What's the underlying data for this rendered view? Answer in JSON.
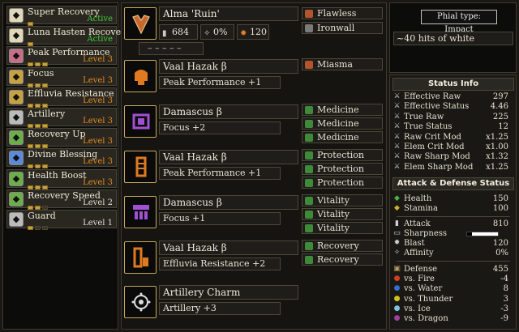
{
  "skills": [
    {
      "name": "Super Recovery",
      "level": "Active",
      "level_color": "act",
      "icon": "super-recovery-icon",
      "icon_color": "#e0d8b8",
      "bars": 1,
      "filled": 1
    },
    {
      "name": "Luna Hasten Recovery",
      "level": "Active",
      "level_color": "act",
      "icon": "hasten-recovery-icon",
      "icon_color": "#e0d8b8",
      "bars": 1,
      "filled": 1
    },
    {
      "name": "Peak Performance",
      "level": "Level 3",
      "level_color": "orange",
      "icon": "peak-performance-icon",
      "icon_color": "#c86d8a",
      "bars": 3,
      "filled": 3
    },
    {
      "name": "Focus",
      "level": "Level 3",
      "level_color": "orange",
      "icon": "focus-icon",
      "icon_color": "#c8a240",
      "bars": 3,
      "filled": 3
    },
    {
      "name": "Effluvia Resistance",
      "level": "Level 3",
      "level_color": "orange",
      "icon": "effluvia-resistance-icon",
      "icon_color": "#c8a240",
      "bars": 3,
      "filled": 3
    },
    {
      "name": "Artillery",
      "level": "Level 3",
      "level_color": "orange",
      "icon": "artillery-icon",
      "icon_color": "#bbbbbb",
      "bars": 3,
      "filled": 3
    },
    {
      "name": "Recovery Up",
      "level": "Level 3",
      "level_color": "orange",
      "icon": "recovery-up-icon",
      "icon_color": "#6cae4a",
      "bars": 3,
      "filled": 3
    },
    {
      "name": "Divine Blessing",
      "level": "Level 3",
      "level_color": "orange",
      "icon": "divine-blessing-icon",
      "icon_color": "#5a8ad8",
      "bars": 3,
      "filled": 3
    },
    {
      "name": "Health Boost",
      "level": "Level 3",
      "level_color": "orange",
      "icon": "health-boost-icon",
      "icon_color": "#6cae4a",
      "bars": 3,
      "filled": 3
    },
    {
      "name": "Recovery Speed",
      "level": "Level 2",
      "level_color": "white",
      "icon": "recovery-speed-icon",
      "icon_color": "#6cae4a",
      "bars": 3,
      "filled": 2
    },
    {
      "name": "Guard",
      "level": "Level 1",
      "level_color": "white",
      "icon": "guard-icon",
      "icon_color": "#bbbbbb",
      "bars": 3,
      "filled": 1
    }
  ],
  "weapon": {
    "name": "Alma 'Ruin'",
    "attack": "684",
    "affinity": "0%",
    "element": "120",
    "slot_dash": "– – – – –",
    "decos": [
      "Flawless",
      "Ironwall"
    ],
    "deco_colors": [
      "red",
      "gray"
    ],
    "icon": "charge-blade-icon"
  },
  "armor": [
    {
      "name": "Vaal Hazak β",
      "skill": "Peak Performance +1",
      "decos": [
        "Miasma"
      ],
      "deco_colors": [
        "red"
      ],
      "icon": "helm-icon",
      "icon_color": "#e07a20"
    },
    {
      "name": "Damascus β",
      "skill": "Focus +2",
      "decos": [
        "Medicine",
        "Medicine",
        "Medicine"
      ],
      "deco_colors": [
        "green",
        "green",
        "green"
      ],
      "icon": "chest-icon",
      "icon_color": "#a050d0"
    },
    {
      "name": "Vaal Hazak β",
      "skill": "Peak Performance +1",
      "decos": [
        "Protection",
        "Protection",
        "Protection"
      ],
      "deco_colors": [
        "green",
        "green",
        "green"
      ],
      "icon": "arms-icon",
      "icon_color": "#e07a20"
    },
    {
      "name": "Damascus β",
      "skill": "Focus +1",
      "decos": [
        "Vitality",
        "Vitality",
        "Vitality"
      ],
      "deco_colors": [
        "green",
        "green",
        "green"
      ],
      "icon": "waist-icon",
      "icon_color": "#a050d0"
    },
    {
      "name": "Vaal Hazak β",
      "skill": "Effluvia Resistance +2",
      "decos": [
        "Recovery",
        "Recovery"
      ],
      "deco_colors": [
        "green",
        "green"
      ],
      "icon": "legs-icon",
      "icon_color": "#e07a20"
    }
  ],
  "charm": {
    "name": "Artillery Charm",
    "skill": "Artillery +3",
    "icon": "charm-icon"
  },
  "phial": {
    "type": "Phial type: Impact",
    "desc": "~40 hits of white"
  },
  "status": {
    "header": "Status Info",
    "rows": [
      {
        "label": "Effective Raw",
        "value": "297",
        "icon": "sword-icon"
      },
      {
        "label": "Effective Status",
        "value": "4.46",
        "icon": "sword-icon"
      },
      {
        "label": "True Raw",
        "value": "225",
        "icon": "sword-icon"
      },
      {
        "label": "True Status",
        "value": "12",
        "icon": "sword-icon"
      },
      {
        "label": "Raw Crit Mod",
        "value": "x1.25",
        "icon": "sword-icon"
      },
      {
        "label": "Elem Crit Mod",
        "value": "x1.00",
        "icon": "sword-icon"
      },
      {
        "label": "Raw Sharp Mod",
        "value": "x1.32",
        "icon": "sword-icon"
      },
      {
        "label": "Elem Sharp Mod",
        "value": "x1.25",
        "icon": "sword-icon"
      }
    ]
  },
  "attack_defense": {
    "header": "Attack & Defense Status",
    "vitals": [
      {
        "label": "Health",
        "value": "150",
        "icon": "health-icon",
        "color": "#4ab04a"
      },
      {
        "label": "Stamina",
        "value": "100",
        "icon": "stamina-icon",
        "color": "#d0b020"
      }
    ],
    "offense": [
      {
        "label": "Attack",
        "value": "810",
        "icon": "attack-icon"
      },
      {
        "label": "Sharpness",
        "value": "",
        "icon": "sharpness-icon"
      },
      {
        "label": "Blast",
        "value": "120",
        "icon": "blast-icon"
      },
      {
        "label": "Affinity",
        "value": "0%",
        "icon": "affinity-icon"
      }
    ],
    "defense": [
      {
        "label": "Defense",
        "value": "455",
        "icon": "defense-icon",
        "color": "#b89860"
      },
      {
        "label": "vs. Fire",
        "value": "-4",
        "icon": "fire-icon",
        "color": "#d04020"
      },
      {
        "label": "vs. Water",
        "value": "8",
        "icon": "water-icon",
        "color": "#3070d0"
      },
      {
        "label": "vs. Thunder",
        "value": "3",
        "icon": "thunder-icon",
        "color": "#d0c020"
      },
      {
        "label": "vs. Ice",
        "value": "-3",
        "icon": "ice-icon",
        "color": "#80c0e0"
      },
      {
        "label": "vs. Dragon",
        "value": "-9",
        "icon": "dragon-icon",
        "color": "#a040a0"
      }
    ]
  }
}
